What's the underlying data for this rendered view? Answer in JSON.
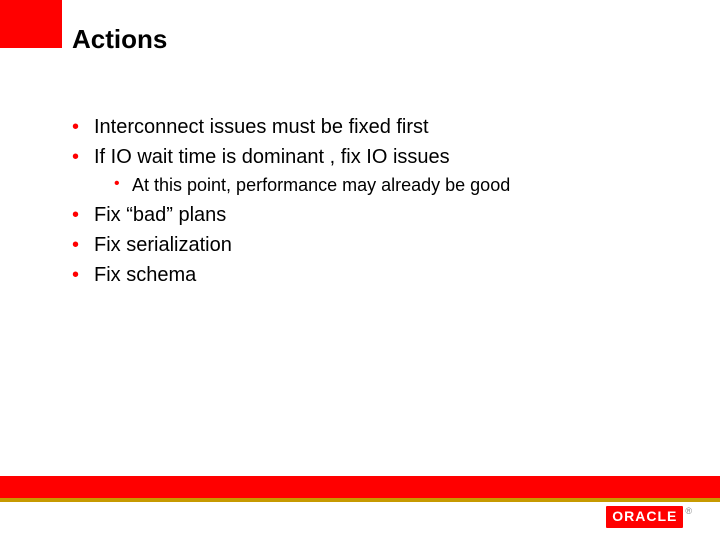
{
  "title": "Actions",
  "bullets": {
    "b1": "Interconnect issues must be fixed first",
    "b2": "If IO wait time is dominant , fix IO issues",
    "b2_1": "At this point, performance may already be good",
    "b3": "Fix “bad” plans",
    "b4": "Fix serialization",
    "b5": "Fix schema"
  },
  "logo_text": "ORACLE",
  "logo_reg": "®"
}
